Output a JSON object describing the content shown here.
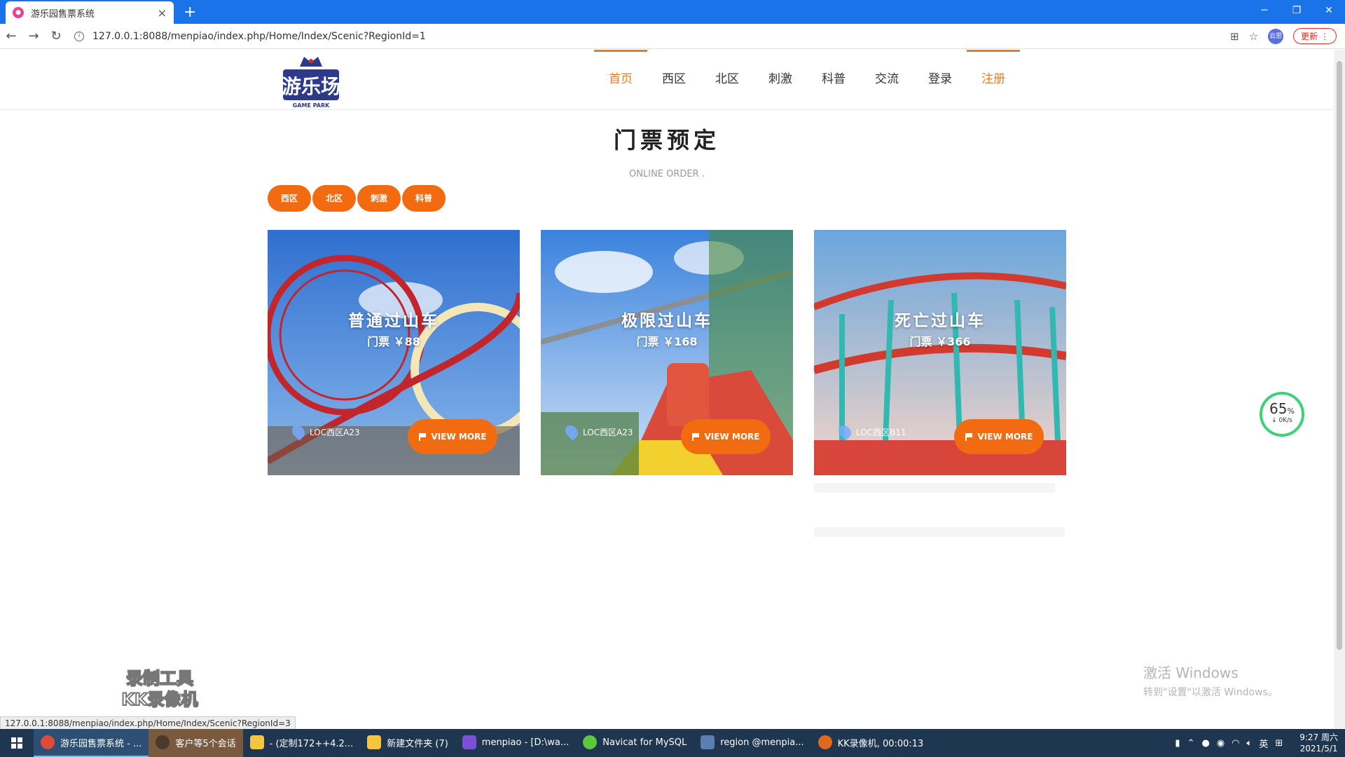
{
  "browser": {
    "tab_title": "游乐园售票系统",
    "tab_close": "×",
    "new_tab": "+",
    "url": "127.0.0.1:8088/menpiao/index.php/Home/Index/Scenic?RegionId=1",
    "update_label": "更新",
    "avatar_text": "云思",
    "status_url": "127.0.0.1:8088/menpiao/index.php/Home/Index/Scenic?RegionId=3"
  },
  "site": {
    "logo_text": "游乐场",
    "logo_sub": "GAME PARK",
    "nav": [
      {
        "label": "首页",
        "active": true
      },
      {
        "label": "西区"
      },
      {
        "label": "北区"
      },
      {
        "label": "刺激"
      },
      {
        "label": "科普"
      },
      {
        "label": "交流"
      },
      {
        "label": "登录"
      },
      {
        "label": "注册"
      }
    ],
    "title": "门票预定",
    "subtitle": "ONLINE ORDER .",
    "filters": [
      "西区",
      "北区",
      "刺激",
      "科普"
    ],
    "cards": [
      {
        "name": "普通过山车",
        "price": "门票 ￥88",
        "loc": "LOC西区A23",
        "button": "VIEW MORE"
      },
      {
        "name": "极限过山车",
        "price": "门票 ￥168",
        "loc": "LOC西区A23",
        "button": "VIEW MORE"
      },
      {
        "name": "死亡过山车",
        "price": "门票 ￥366",
        "loc": "LOC西区B11",
        "button": "VIEW MORE"
      }
    ]
  },
  "overlay": {
    "speed_pct": "65",
    "speed_unit": "%",
    "speed_rate": "↓ 0K/s",
    "watermark_line1": "录制工具",
    "watermark_line2": "KK录像机",
    "activate_line1": "激活 Windows",
    "activate_line2": "转到\"设置\"以激活 Windows。"
  },
  "taskbar": {
    "items": [
      {
        "label": "游乐园售票系统 - ...",
        "color": "#dd4b39"
      },
      {
        "label": "客户等5个会话",
        "color": "#8a6d4e"
      },
      {
        "label": "- (定制172++4.2...",
        "color": "#f5c542"
      },
      {
        "label": "新建文件夹 (7)",
        "color": "#f5c542"
      },
      {
        "label": "menpiao - [D:\\wa...",
        "color": "#7b4fd6"
      },
      {
        "label": "Navicat for MySQL",
        "color": "#5cc83e"
      },
      {
        "label": "region @menpia...",
        "color": "#5a7fb0"
      },
      {
        "label": "KK录像机, 00:00:13",
        "color": "#e06a1b"
      }
    ],
    "ime": "英",
    "time": "9:27 周六",
    "date": "2021/5/1"
  },
  "colors": {
    "accent": "#f26b10",
    "browser_blue": "#1a73e8",
    "taskbar": "#1e3650"
  }
}
